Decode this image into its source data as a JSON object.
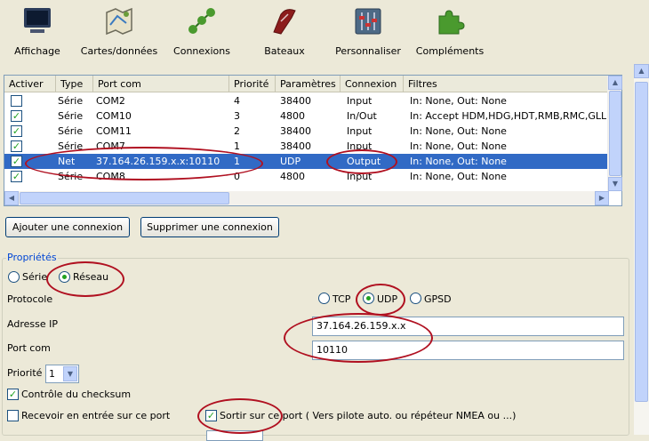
{
  "toolbar": {
    "items": [
      {
        "label": "Affichage",
        "icon": "monitor-icon"
      },
      {
        "label": "Cartes/données",
        "icon": "charts-icon"
      },
      {
        "label": "Connexions",
        "icon": "connections-icon"
      },
      {
        "label": "Bateaux",
        "icon": "boat-icon"
      },
      {
        "label": "Personnaliser",
        "icon": "sliders-icon"
      },
      {
        "label": "Compléments",
        "icon": "puzzle-icon"
      }
    ]
  },
  "connections": {
    "headers": [
      "Activer",
      "Type",
      "Port com",
      "Priorité",
      "Paramètres",
      "Connexion",
      "Filtres"
    ],
    "rows": [
      {
        "enabled": false,
        "type": "Série",
        "port": "COM2",
        "priority": "4",
        "params": "38400",
        "connection": "Input",
        "filters": "In: None, Out: None"
      },
      {
        "enabled": true,
        "type": "Série",
        "port": "COM10",
        "priority": "3",
        "params": "4800",
        "connection": "In/Out",
        "filters": "In: Accept HDM,HDG,HDT,RMB,RMC,GLL"
      },
      {
        "enabled": true,
        "type": "Série",
        "port": "COM11",
        "priority": "2",
        "params": "38400",
        "connection": "Input",
        "filters": "In: None, Out: None"
      },
      {
        "enabled": true,
        "type": "Série",
        "port": "COM7",
        "priority": "1",
        "params": "38400",
        "connection": "Input",
        "filters": "In: None, Out: None"
      },
      {
        "enabled": true,
        "type": "Net",
        "port": "37.164.26.159.x.x:10110",
        "priority": "1",
        "params": "UDP",
        "connection": "Output",
        "filters": "In: None, Out: None",
        "selected": true
      },
      {
        "enabled": true,
        "type": "Série",
        "port": "COM8",
        "priority": "0",
        "params": "4800",
        "connection": "Input",
        "filters": "In: None, Out: None"
      }
    ]
  },
  "buttons": {
    "add": "Ajouter une connexion",
    "remove": "Supprimer une connexion"
  },
  "properties": {
    "legend": "Propriétés",
    "type_serial": "Série",
    "type_network": "Réseau",
    "type_selected": "network",
    "protocol_label": "Protocole",
    "protocol_tcp": "TCP",
    "protocol_udp": "UDP",
    "protocol_gpsd": "GPSD",
    "protocol_selected": "UDP",
    "ip_label": "Adresse IP",
    "ip_value": "37.164.26.159.x.x",
    "port_label": "Port com",
    "port_value": "10110",
    "priority_label": "Priorité",
    "priority_value": "1",
    "checksum_label": "Contrôle du checksum",
    "checksum_checked": true,
    "receive_label": "Recevoir en entrée sur ce port",
    "receive_checked": false,
    "output_label": "Sortir sur ce port ( Vers pilote auto. ou répéteur NMEA ou ...)",
    "output_checked": true
  },
  "colors": {
    "selection": "#316ac5",
    "annotation": "#b01020",
    "legend": "#0046d5"
  }
}
